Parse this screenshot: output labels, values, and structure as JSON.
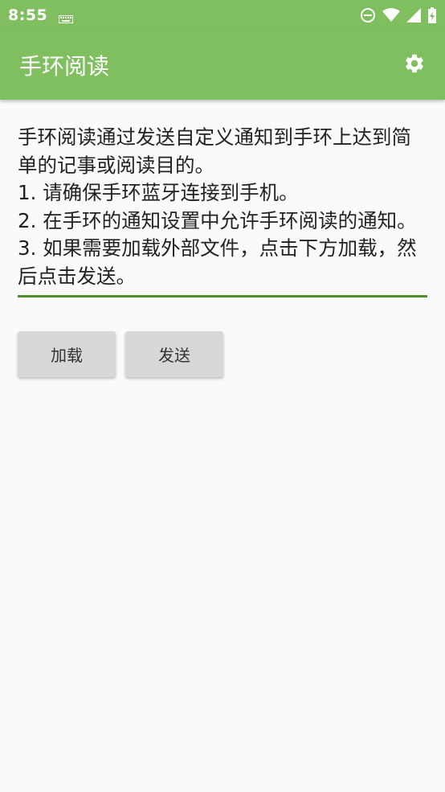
{
  "status_bar": {
    "time": "8:55",
    "icons": [
      "keyboard-icon",
      "do-not-disturb-icon",
      "wifi-icon",
      "signal-icon",
      "battery-icon"
    ]
  },
  "app_bar": {
    "title": "手环阅读",
    "settings_icon": "gear-icon"
  },
  "main": {
    "instructions": "手环阅读通过发送自定义通知到手环上达到简单的记事或阅读目的。\n1. 请确保手环蓝牙连接到手机。\n2. 在手环的通知设置中允许手环阅读的通知。\n3. 如果需要加载外部文件，点击下方加载，然后点击发送。",
    "load_label": "加载",
    "send_label": "发送"
  },
  "colors": {
    "primary": "#7fbf5f",
    "accent_underline": "#4d8e2a",
    "button_bg": "#d8d8d8"
  }
}
